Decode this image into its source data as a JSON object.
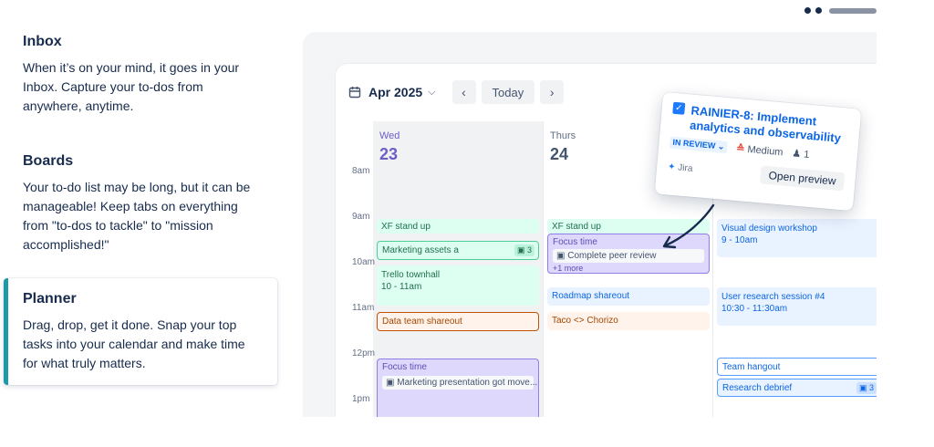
{
  "features": [
    {
      "title": "Inbox",
      "text": "When it’s on your mind, it goes in your Inbox. Capture your to-dos from anywhere, anytime."
    },
    {
      "title": "Boards",
      "text": "Your to-do list may be long, but it can be manageable! Keep tabs on everything from \"to-dos to tackle\" to \"mission accomplished!\""
    },
    {
      "title": "Planner",
      "text": "Drag, drop, get it done. Snap your top tasks into your calendar and make time for what truly matters."
    }
  ],
  "calendar": {
    "month": "Apr 2025",
    "today_label": "Today",
    "days": [
      {
        "name": "Wed",
        "num": "23"
      },
      {
        "name": "Thurs",
        "num": "24"
      }
    ],
    "hours": [
      "8am",
      "9am",
      "10am",
      "11am",
      "12pm",
      "1pm"
    ],
    "events": {
      "wed_standup": "XF stand up",
      "marketing_assets": "Marketing assets a",
      "marketing_assets_count": "3",
      "townhall": "Trello townhall",
      "townhall_time": "10 - 11am",
      "data_team": "Data team shareout",
      "focus_wed": "Focus time",
      "focus_wed_card": "Marketing presentation got move...",
      "thu_standup": "XF stand up",
      "focus_thu": "Focus time",
      "focus_thu_card": "Complete peer review",
      "focus_thu_more": "+1 more",
      "roadmap": "Roadmap shareout",
      "taco": "Taco <> Chorizo",
      "visual_design": "Visual design workshop",
      "visual_design_time": "9 - 10am",
      "user_research": "User research session #4",
      "user_research_time": "10:30 - 11:30am",
      "team_hangout": "Team hangout",
      "research_debrief": "Research debrief",
      "research_debrief_count": "3"
    }
  },
  "jira_card": {
    "title": "RAINIER-8: Implement analytics and observability",
    "status": "IN REVIEW ⌄",
    "priority": "Medium",
    "assignees": "1",
    "source": "Jira",
    "open_label": "Open preview"
  }
}
